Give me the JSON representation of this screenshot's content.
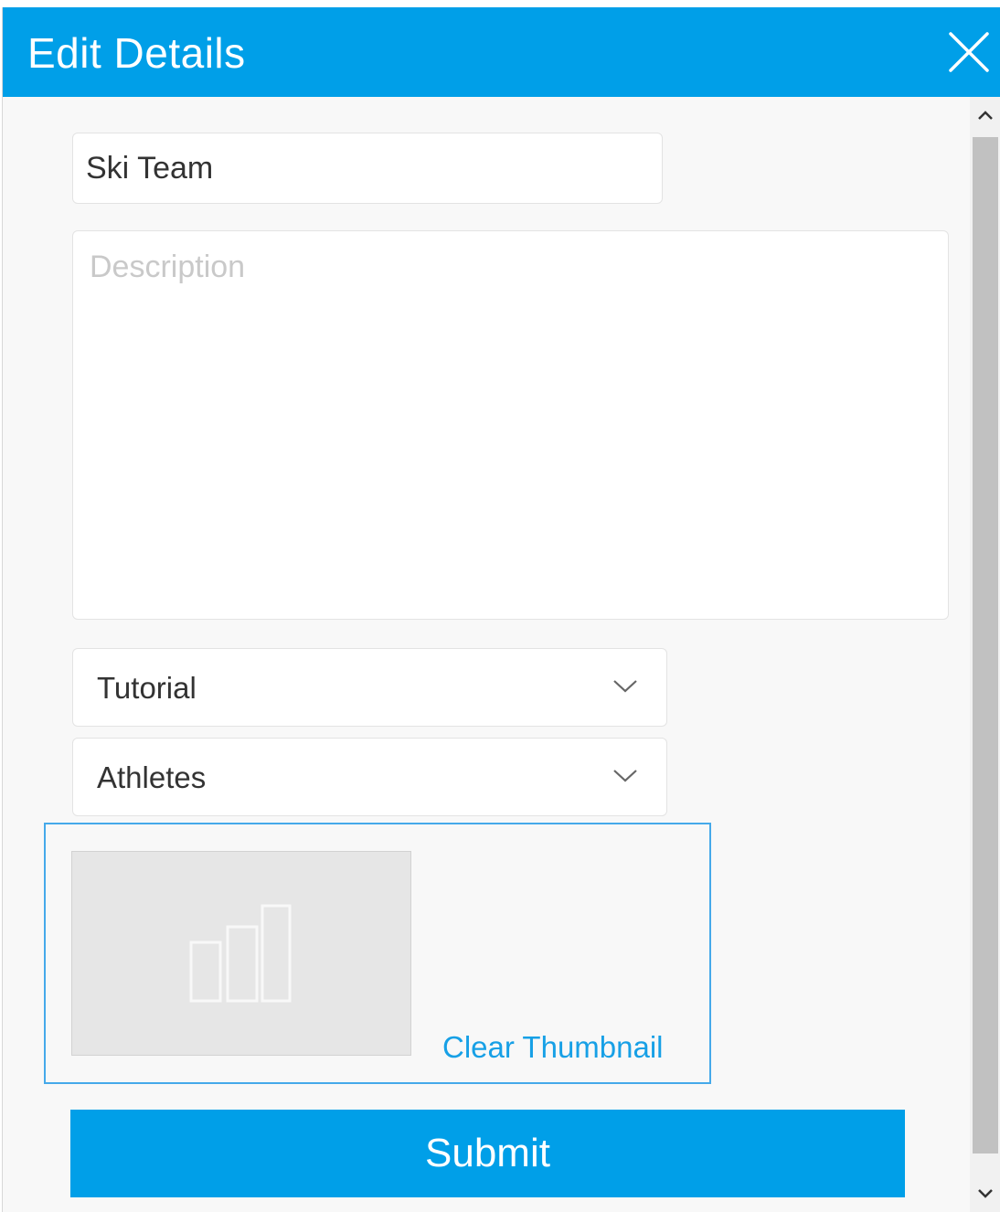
{
  "dialog": {
    "title": "Edit Details",
    "close_icon": "close-icon"
  },
  "form": {
    "name_value": "Ski Team",
    "description_value": "",
    "description_placeholder": "Description",
    "category_value": "Tutorial",
    "subcategory_value": "Athletes"
  },
  "thumbnail": {
    "placeholder_icon": "bar-chart-icon",
    "clear_label": "Clear Thumbnail"
  },
  "actions": {
    "submit_label": "Submit"
  },
  "colors": {
    "accent": "#009fe8",
    "link": "#17a0e6",
    "panel_border": "#45a9ea"
  }
}
